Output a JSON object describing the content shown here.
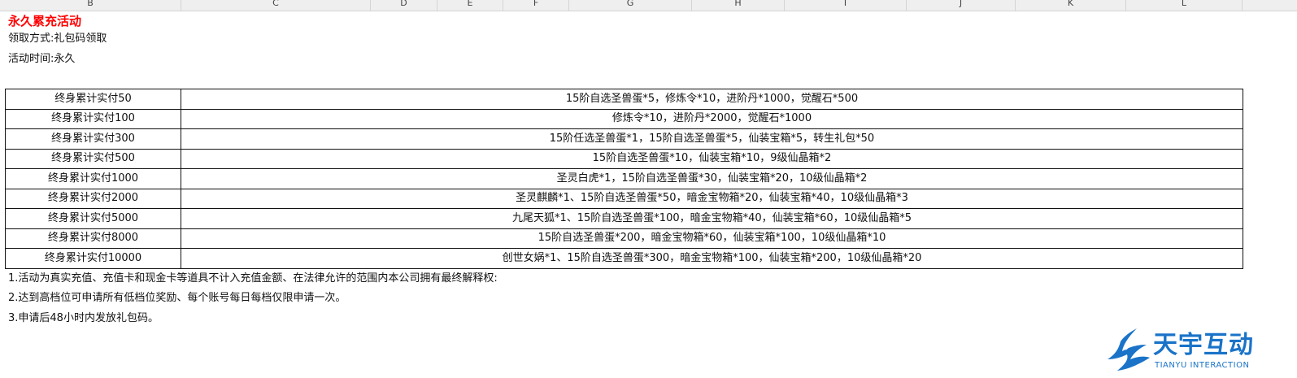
{
  "spreadsheet": {
    "columns": [
      "B",
      "C",
      "D",
      "E",
      "F",
      "G",
      "H",
      "I",
      "J",
      "K",
      "L"
    ]
  },
  "event": {
    "title": "永久累充活动",
    "claim_method": "领取方式:礼包码领取",
    "event_time": "活动时间:永久"
  },
  "rewards": [
    {
      "tier": "终身累计实付50",
      "reward": "15阶自选圣兽蛋*5，修炼令*10，进阶丹*1000，觉醒石*500"
    },
    {
      "tier": "终身累计实付100",
      "reward": "修炼令*10，进阶丹*2000，觉醒石*1000"
    },
    {
      "tier": "终身累计实付300",
      "reward": "15阶任选圣兽蛋*1，15阶自选圣兽蛋*5，仙装宝箱*5，转生礼包*50"
    },
    {
      "tier": "终身累计实付500",
      "reward": "15阶自选圣兽蛋*10，仙装宝箱*10，9级仙晶箱*2"
    },
    {
      "tier": "终身累计实付1000",
      "reward": "圣灵白虎*1，15阶自选圣兽蛋*30，仙装宝箱*20，10级仙晶箱*2"
    },
    {
      "tier": "终身累计实付2000",
      "reward": "圣灵麒麟*1、15阶自选圣兽蛋*50，暗金宝物箱*20，仙装宝箱*40，10级仙晶箱*3"
    },
    {
      "tier": "终身累计实付5000",
      "reward": "九尾天狐*1、15阶自选圣兽蛋*100，暗金宝物箱*40，仙装宝箱*60，10级仙晶箱*5"
    },
    {
      "tier": "终身累计实付8000",
      "reward": "15阶自选圣兽蛋*200，暗金宝物箱*60，仙装宝箱*100，10级仙晶箱*10"
    },
    {
      "tier": "终身累计实付10000",
      "reward": "创世女娲*1、15阶自选圣兽蛋*300，暗金宝物箱*100，仙装宝箱*200，10级仙晶箱*20"
    }
  ],
  "notes": [
    "1.活动为真实充值、充值卡和现金卡等道具不计入充值金额、在法律允许的范围内本公司拥有最终解释权:",
    "2.达到高档位可申请所有低档位奖励、每个账号每日每档仅限申请一次。",
    "3.申请后48小时内发放礼包码。"
  ],
  "logo": {
    "name": "天宇互动",
    "subtitle": "TIANYU INTERACTION",
    "color": "#1a73c8"
  },
  "colors": {
    "title": "#ff0000",
    "border": "#111111",
    "header_bg": "#efefef"
  }
}
